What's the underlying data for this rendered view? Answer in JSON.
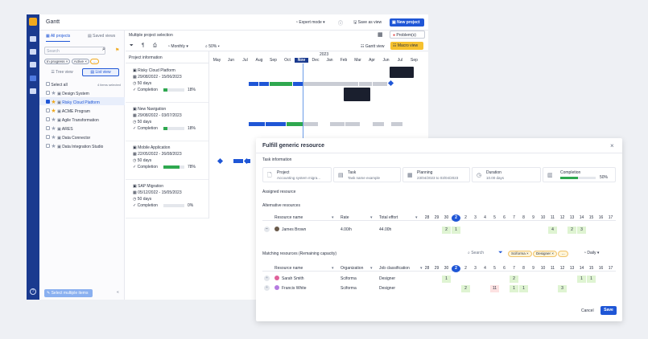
{
  "app": {
    "title": "Gantt"
  },
  "topbar": {
    "expert_mode": "Expert mode",
    "save_as_view": "Save as view",
    "new_project": "New project"
  },
  "sidebar": {
    "tabs": [
      "All projects",
      "Saved views"
    ],
    "search_placeholder": "Search",
    "filters": [
      "In progress",
      "Active"
    ],
    "tree_view": "Tree view",
    "list_view": "List view",
    "select_all": "Select all",
    "selected_count": "4 items selected",
    "projects": [
      {
        "name": "Design System",
        "checked": false,
        "star": false
      },
      {
        "name": "Risky Cloud Platform",
        "checked": true,
        "star": true
      },
      {
        "name": "ACME Program",
        "checked": false,
        "star": true
      },
      {
        "name": "Agile Transformation",
        "checked": false,
        "star": false
      },
      {
        "name": "ARES",
        "checked": false,
        "star": false
      },
      {
        "name": "Data Connector",
        "checked": false,
        "star": false
      },
      {
        "name": "Data Integration Studio",
        "checked": false,
        "star": false
      }
    ],
    "select_multiple": "Select multiple items"
  },
  "main": {
    "title": "Multiple project selection",
    "problems": "Problem(s)",
    "monthly": "Monthly",
    "zoom": "50%",
    "gantt_view": "Gantt view",
    "macro_view": "Macro view",
    "project_info": "Project information",
    "year": "2023",
    "months": [
      "May",
      "Jun",
      "Jul",
      "Aug",
      "Sep",
      "Oct",
      "Nov",
      "Dec",
      "Jan",
      "Feb",
      "Mar",
      "Apr",
      "Jun",
      "Jul",
      "Sep"
    ]
  },
  "projects": [
    {
      "name": "Risky Cloud Platform",
      "dates": "29/08/2022 - 15/06/2023",
      "days": "50 days",
      "completion_label": "Completion",
      "completion": "18%",
      "pct": 18
    },
    {
      "name": "New Navigation",
      "dates": "29/08/2022 - 03/07/2023",
      "days": "50 days",
      "completion_label": "Completion",
      "completion": "18%",
      "pct": 18
    },
    {
      "name": "Mobile Application",
      "dates": "22/05/2022 - 26/08/2023",
      "days": "50 days",
      "completion_label": "Completion",
      "completion": "78%",
      "pct": 78
    },
    {
      "name": "SAP Migration",
      "dates": "05/12/2022 - 15/05/2023",
      "days": "50 days",
      "completion_label": "Completion",
      "completion": "0%",
      "pct": 0
    }
  ],
  "modal": {
    "title": "Fulfill generic resource",
    "task_info": "Task information",
    "project_label": "Project",
    "project_value": "Accounting system migra...",
    "task_label": "Task",
    "task_value": "Task name example",
    "planning_label": "Planning",
    "planning_value": "23/04/2023 to 03/04/2023",
    "duration_label": "Duration",
    "duration_value": "10.00 days",
    "completion_label": "Completion",
    "completion_value": "50%",
    "completion_pct": 50,
    "assigned": "Assigned resource",
    "alternative": "Alternative resources",
    "alt_cols": [
      "Resource name",
      "Rate",
      "Total effort"
    ],
    "alt_rows": [
      {
        "name": "James Brown",
        "rate": "4.00/h",
        "effort": "44.00h"
      }
    ],
    "days": [
      "28",
      "29",
      "30",
      "2",
      "2",
      "3",
      "4",
      "5",
      "6",
      "7",
      "8",
      "9",
      "10",
      "11",
      "12",
      "13",
      "14",
      "15",
      "16",
      "17"
    ],
    "matching": "Matching resources (Remaining capacity)",
    "search": "Search",
    "tags": [
      "Sciforma",
      "Designer"
    ],
    "daily": "Daily",
    "match_cols": [
      "Resource name",
      "Organization",
      "Job classification"
    ],
    "match_rows": [
      {
        "name": "Sarah Smith",
        "org": "Sciforma",
        "job": "Designer"
      },
      {
        "name": "Francis White",
        "org": "Sciforma",
        "job": "Designer"
      }
    ],
    "cancel": "Cancel",
    "save": "Save"
  }
}
